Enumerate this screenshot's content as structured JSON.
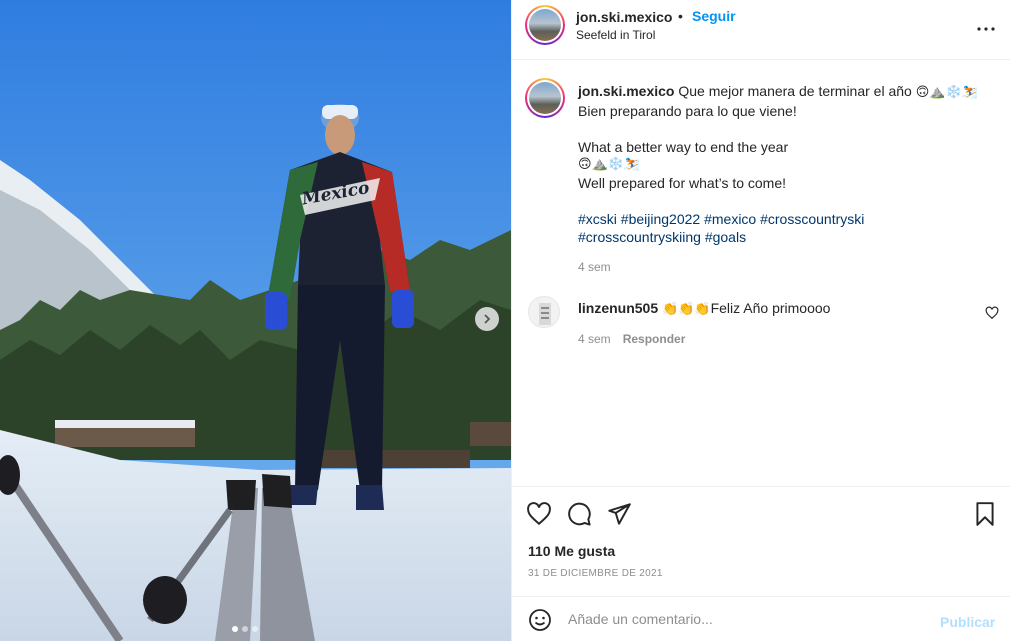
{
  "post": {
    "username": "jon.ski.mexico",
    "separator": "•",
    "follow_label": "Seguir",
    "location": "Seefeld in Tirol",
    "photo": {
      "jacket_text": "Mexico",
      "slide_count": 3,
      "active_slide": 1
    }
  },
  "caption": {
    "username": "jon.ski.mexico",
    "line1": "Que mejor manera de terminar el año",
    "line1_emoji": "🙃⛰️❄️⛷️",
    "line2": "Bien preparando para lo que viene!",
    "line3": "What a better way to end the year",
    "line4_emoji": "🙃⛰️❄️⛷️",
    "line5": "Well prepared for what’s to come!",
    "hashtags_line1": "#xcski #beijing2022 #mexico #crosscountryski",
    "hashtags_line2": "#crosscountryskiing #goals",
    "time": "4 sem"
  },
  "comment": {
    "username": "linzenun505",
    "emoji": "👏👏👏",
    "text": "Feliz Año primoooo",
    "time": "4 sem",
    "reply_label": "Responder"
  },
  "actions": {
    "likes": "110 Me gusta",
    "date": "31 DE DICIEMBRE DE 2021"
  },
  "add_comment": {
    "placeholder": "Añade un comentario...",
    "publish_label": "Publicar"
  },
  "colors": {
    "link_blue": "#0095f6",
    "hashtag_blue": "#00376b",
    "muted_gray": "#8e8e8e",
    "publish_disabled": "#b2dffc"
  },
  "icons": [
    "next-arrow-icon",
    "more-options-icon",
    "heart-icon",
    "comment-icon",
    "share-icon",
    "bookmark-icon",
    "emoji-icon",
    "small-heart-icon"
  ]
}
